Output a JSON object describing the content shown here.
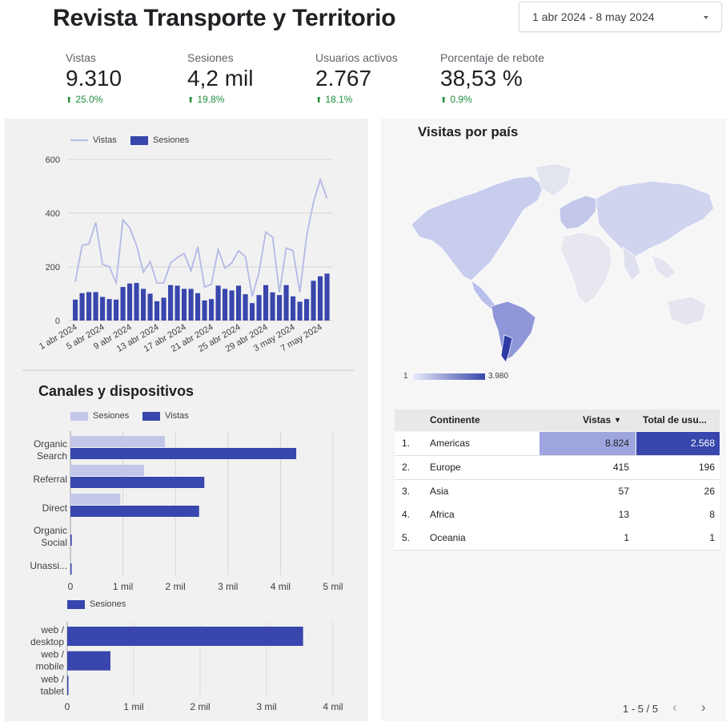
{
  "header": {
    "title": "Revista Transporte y Territorio",
    "date_range": "1 abr 2024 - 8 may 2024"
  },
  "kpis": [
    {
      "label": "Vistas",
      "value": "9.310",
      "delta": "25.0%"
    },
    {
      "label": "Sesiones",
      "value": "4,2 mil",
      "delta": "19.8%"
    },
    {
      "label": "Usuarios activos",
      "value": "2.767",
      "delta": "18.1%"
    },
    {
      "label": "Porcentaje de rebote",
      "value": "38,53 %",
      "delta": "0.9%"
    }
  ],
  "colors": {
    "dark": "#3846ad",
    "light": "#c3c8ea",
    "line": "#b3b9e6",
    "positive": "#1e8e3e"
  },
  "chart_data": [
    {
      "type": "bar",
      "title": "",
      "legend": [
        "Vistas",
        "Sesiones"
      ],
      "legend_position": "top-left",
      "x_tick_labels": [
        "1 abr 2024",
        "5 abr 2024",
        "9 abr 2024",
        "13 abr 2024",
        "17 abr 2024",
        "21 abr 2024",
        "25 abr 2024",
        "29 abr 2024",
        "3 may 2024",
        "7 may 2024"
      ],
      "y_tick_labels": [
        "0",
        "200",
        "400",
        "600"
      ],
      "ylim": [
        0,
        600
      ],
      "grid": true,
      "series": [
        {
          "name": "Sesiones",
          "type": "bar",
          "values": [
            78,
            102,
            106,
            106,
            88,
            80,
            78,
            125,
            138,
            140,
            118,
            100,
            72,
            85,
            132,
            130,
            118,
            118,
            102,
            75,
            80,
            130,
            118,
            112,
            130,
            98,
            65,
            95,
            132,
            105,
            95,
            132,
            90,
            70,
            80,
            148,
            165,
            175
          ]
        },
        {
          "name": "Vistas",
          "type": "line",
          "values": [
            145,
            280,
            285,
            365,
            210,
            200,
            140,
            375,
            345,
            280,
            180,
            220,
            140,
            140,
            215,
            235,
            250,
            185,
            275,
            125,
            135,
            265,
            195,
            215,
            260,
            238,
            90,
            180,
            330,
            310,
            105,
            270,
            260,
            105,
            315,
            440,
            525,
            455
          ]
        }
      ]
    },
    {
      "type": "bar",
      "title": "Canales y dispositivos",
      "orientation": "horizontal",
      "categories": [
        "Organic Search",
        "Referral",
        "Direct",
        "Organic Social",
        "Unassi..."
      ],
      "x_tick_labels": [
        "0",
        "1 mil",
        "2 mil",
        "3 mil",
        "4 mil",
        "5 mil"
      ],
      "xlim": [
        0,
        5000
      ],
      "legend_position": "top-left",
      "series": [
        {
          "name": "Sesiones",
          "values": [
            1800,
            1400,
            950,
            0,
            0
          ]
        },
        {
          "name": "Vistas",
          "values": [
            4300,
            2550,
            2450,
            25,
            10
          ]
        }
      ]
    },
    {
      "type": "bar",
      "orientation": "horizontal",
      "categories": [
        "web / desktop",
        "web / mobile",
        "web / tablet"
      ],
      "x_tick_labels": [
        "0",
        "1 mil",
        "2 mil",
        "3 mil",
        "4 mil"
      ],
      "xlim": [
        0,
        4000
      ],
      "legend_position": "top-left",
      "series": [
        {
          "name": "Sesiones",
          "values": [
            3550,
            650,
            10
          ]
        }
      ]
    }
  ],
  "map": {
    "title": "Visitas por país",
    "scale_min": "1",
    "scale_max": "3.980"
  },
  "table": {
    "columns": [
      "Continente",
      "Vistas",
      "Total de usu..."
    ],
    "sort_indicator": "▾",
    "rows": [
      {
        "rank": "1.",
        "continent": "Americas",
        "views": "8.824",
        "users": "2.568",
        "views_share": 1.0,
        "users_share": 1.0
      },
      {
        "rank": "2.",
        "continent": "Europe",
        "views": "415",
        "users": "196"
      },
      {
        "rank": "3.",
        "continent": "Asia",
        "views": "57",
        "users": "26"
      },
      {
        "rank": "4.",
        "continent": "Africa",
        "views": "13",
        "users": "8"
      },
      {
        "rank": "5.",
        "continent": "Oceania",
        "views": "1",
        "users": "1"
      }
    ],
    "pager": "1 - 5 / 5",
    "prev_icon": "chevron-left-icon",
    "next_icon": "chevron-right-icon"
  }
}
